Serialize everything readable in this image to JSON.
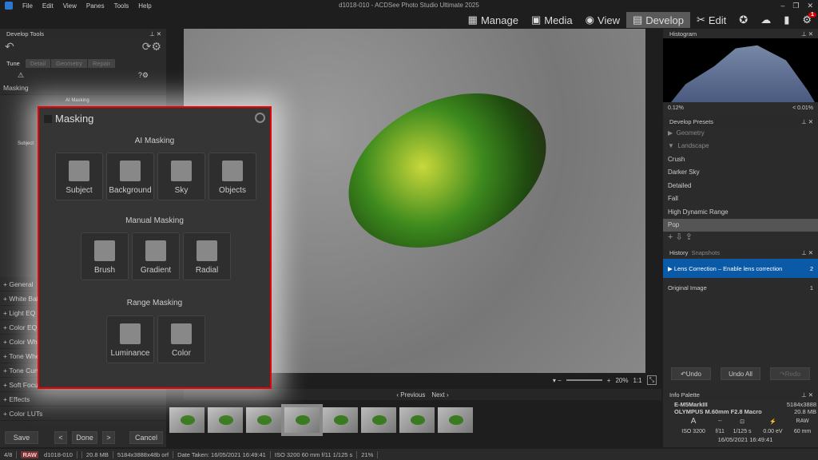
{
  "app": {
    "title": "d1018-010 - ACDSee Photo Studio Ultimate 2025",
    "menu": [
      "File",
      "Edit",
      "View",
      "Panes",
      "Tools",
      "Help"
    ],
    "modes": [
      {
        "label": "Manage",
        "icon": "grid-icon"
      },
      {
        "label": "Media",
        "icon": "media-icon"
      },
      {
        "label": "View",
        "icon": "eye-icon"
      },
      {
        "label": "Develop",
        "icon": "develop-icon",
        "active": true
      },
      {
        "label": "Edit",
        "icon": "edit-icon"
      }
    ],
    "notification_count": "1"
  },
  "left": {
    "title": "Develop Tools",
    "tabs": [
      "Tune",
      "Detail",
      "Geometry",
      "Repair"
    ],
    "masking_label": "Masking",
    "ai_masking_small": "AI Masking",
    "subject_small": "Subject",
    "sections": [
      "General",
      "White Balance",
      "Light EQ",
      "Color EQ",
      "Color Wheels",
      "Tone Wheels",
      "Tone Curves",
      "Soft Focus",
      "Effects",
      "Color LUTs"
    ],
    "buttons": {
      "save": "Save",
      "done": "Done",
      "cancel": "Cancel"
    }
  },
  "popup": {
    "title": "Masking",
    "ai_heading": "AI Masking",
    "ai": [
      "Subject",
      "Background",
      "Sky",
      "Objects"
    ],
    "manual_heading": "Manual Masking",
    "manual": [
      "Brush",
      "Gradient",
      "Radial"
    ],
    "range_heading": "Range Masking",
    "range": [
      "Luminance",
      "Color"
    ],
    "accent": "#e00000"
  },
  "viewer": {
    "zoom": "20%",
    "one_to_one": "1:1",
    "previous": "Previous",
    "next": "Next",
    "thumbnail_count": 8,
    "selected_thumbnail": 4
  },
  "histogram": {
    "title": "Histogram",
    "shadow_clip": "0.12%",
    "highlight_clip": "< 0.01%"
  },
  "presets": {
    "title": "Develop Presets",
    "groups": [
      "Geometry",
      "Landscape"
    ],
    "items": [
      "Crush",
      "Darker Sky",
      "Detailed",
      "Fall",
      "High Dynamic Range",
      "Pop"
    ],
    "selected": "Pop"
  },
  "history": {
    "tabs": [
      "History",
      "Snapshots"
    ],
    "items": [
      {
        "label": "Lens Correction – Enable lens correction",
        "n": "2"
      },
      {
        "label": "Original Image",
        "n": "1"
      }
    ],
    "undo": "Undo",
    "undo_all": "Undo All",
    "redo": "Redo",
    "highlight": "#0a5aa8"
  },
  "info": {
    "title": "Info Palette",
    "camera": "E-M5MarkIII",
    "lens": "OLYMPUS M.60mm F2.8 Macro",
    "dims": "5184x3888",
    "size": "20.8 MB",
    "mode": "A",
    "flash_dash": "--",
    "raw": "RAW",
    "iso": "ISO 3200",
    "fnum": "f/11",
    "shutter": "1/125 s",
    "ev": "0.00 eV",
    "focal": "60 mm",
    "date": "16/05/2021 16:49:41"
  },
  "status": {
    "index": "4/8",
    "raw": "RAW",
    "name": "d1018-010",
    "size": "20.8 MB",
    "dims": "5184x3888x48b orf",
    "date": "Date Taken: 16/05/2021 16:49:41",
    "exif": "ISO 3200   60 mm   f/11   1/125 s",
    "zoom": "21%"
  }
}
